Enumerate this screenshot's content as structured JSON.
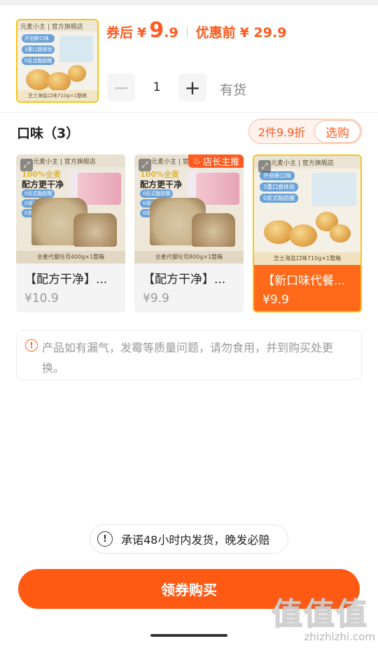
{
  "header": {
    "thumb": {
      "brand": "元麦小主 | 官方旗舰店",
      "tags": [
        "开创新口味",
        "3重口感体验",
        "0反式脂肪酸"
      ],
      "footer": "芝士海盐口味710g×1整箱"
    },
    "price": {
      "after_coupon_label": "券后",
      "currency": "¥",
      "after_coupon_int": "9",
      "after_coupon_dec": ".9",
      "original_label": "优惠前",
      "original_value": "¥ 29.9"
    },
    "stepper": {
      "minus": "−",
      "quantity": "1",
      "plus": "+"
    },
    "stock_status": "有货"
  },
  "flavor": {
    "title": "口味（3）",
    "promo_text": "2件9.9折",
    "promo_button": "选购",
    "items": [
      {
        "name": "【配方干净】...",
        "price": "¥10.9",
        "image": {
          "header": "元麦小主 | 官方旗舰店",
          "slogan1": "100%全麦",
          "slogan2": "配方更干净",
          "tags": [
            "0反式脂肪酸",
            "0添加蔗糖",
            "0添加香精"
          ],
          "footer": "全麦代餐吐司400g×1整箱"
        },
        "selected": false
      },
      {
        "name": "【配方干净】...",
        "price": "¥9.9",
        "badge": "店长主推",
        "image": {
          "header": "元麦小主 | 官方旗舰店",
          "slogan1": "100%全麦",
          "slogan2": "配方更干净",
          "tags": [
            "0反式脂肪酸",
            "0添加蔗糖",
            "0添加香精"
          ],
          "footer": "全麦代餐吐司800g×1整箱"
        },
        "selected": false
      },
      {
        "name": "【新口味代餐...",
        "price": "¥9.9",
        "image": {
          "header": "元麦小主 | 官方旗舰店",
          "tags": [
            "开创新口味",
            "3重口感体验",
            "0反式脂肪酸"
          ],
          "footer": "芝士海盐口味710g×1整箱"
        },
        "selected": true
      }
    ]
  },
  "notice": {
    "icon": "!",
    "text": "产品如有漏气，发霉等质量问题，请勿食用，并到购买处更换。"
  },
  "promise": {
    "icon": "!",
    "text": "承诺48小时内发货，晚发必赔"
  },
  "buy_button": "领券购买",
  "watermark": {
    "big": "值值值",
    "small": "zhizhizhi.com"
  },
  "colors": {
    "accent": "#ff5a14",
    "selected_border": "#f5c518",
    "muted": "#999999"
  }
}
